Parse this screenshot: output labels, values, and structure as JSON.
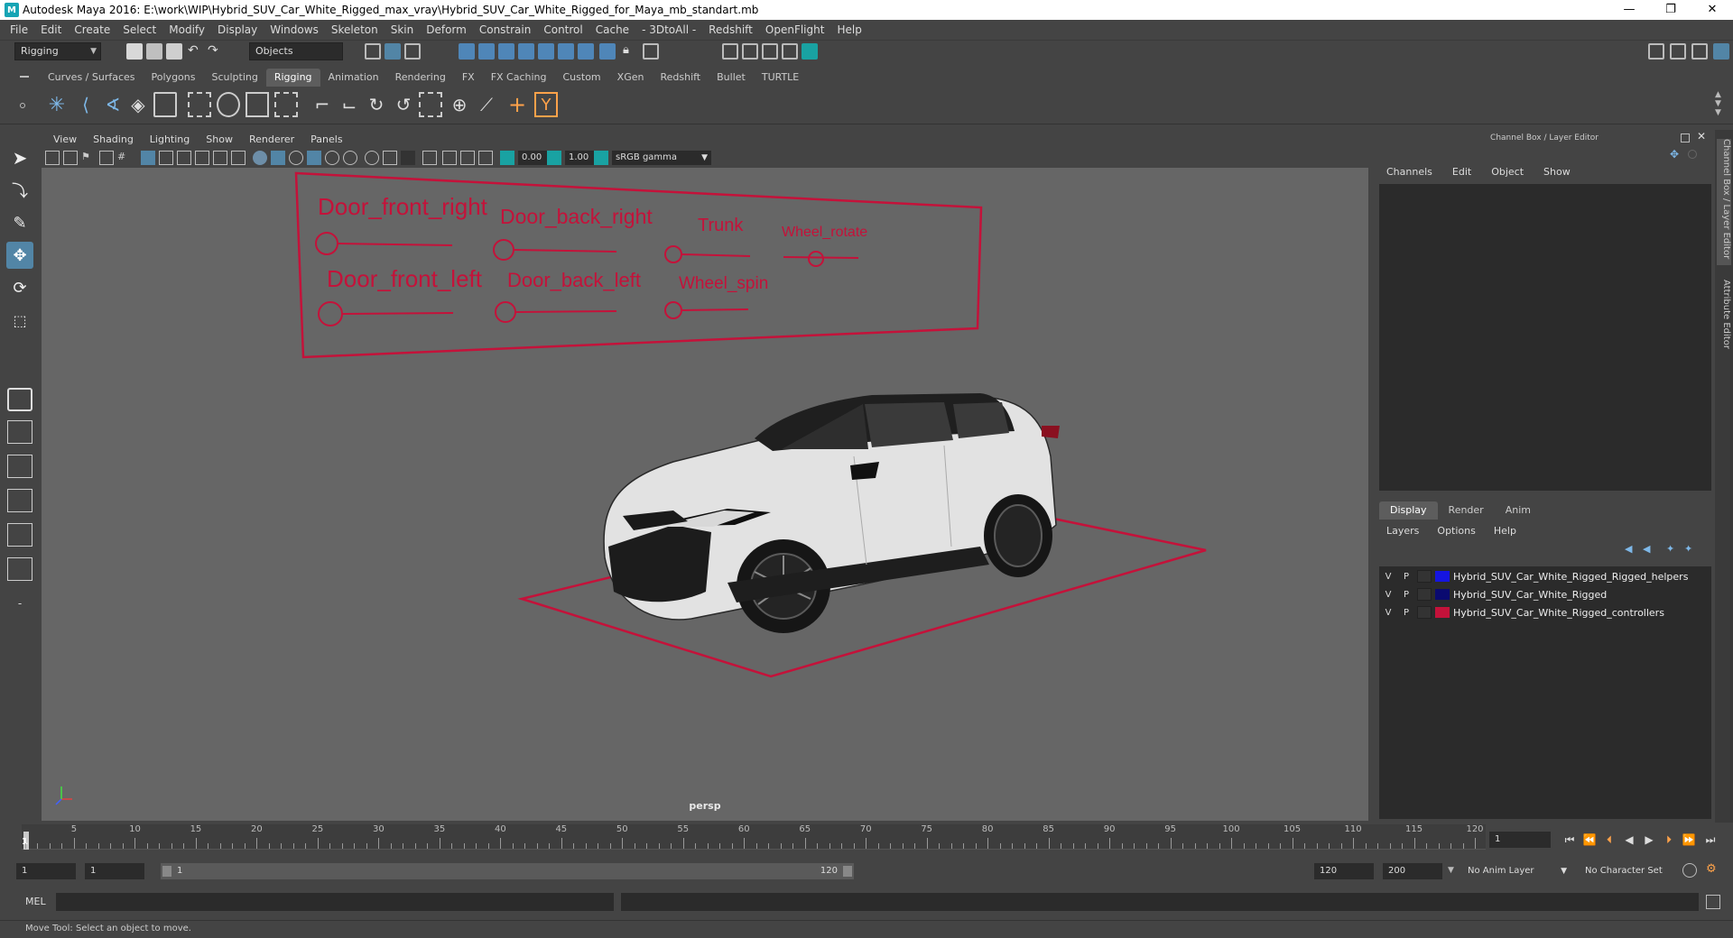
{
  "window": {
    "title": "Autodesk Maya 2016: E:\\work\\WIP\\Hybrid_SUV_Car_White_Rigged_max_vray\\Hybrid_SUV_Car_White_Rigged_for_Maya_mb_standart.mb",
    "min": "—",
    "max": "❐",
    "close": "✕"
  },
  "menubar": [
    "File",
    "Edit",
    "Create",
    "Select",
    "Modify",
    "Display",
    "Windows",
    "Skeleton",
    "Skin",
    "Deform",
    "Constrain",
    "Control",
    "Cache",
    "- 3DtoAll -",
    "Redshift",
    "OpenFlight",
    "Help"
  ],
  "statusline": {
    "menuset": "Rigging",
    "selection_mode": "Objects"
  },
  "shelf_tabs": [
    "Curves / Surfaces",
    "Polygons",
    "Sculpting",
    "Rigging",
    "Animation",
    "Rendering",
    "FX",
    "FX Caching",
    "Custom",
    "XGen",
    "Redshift",
    "Bullet",
    "TURTLE"
  ],
  "shelf_active": "Rigging",
  "viewport": {
    "menu": [
      "View",
      "Shading",
      "Lighting",
      "Show",
      "Renderer",
      "Panels"
    ],
    "near_value": "0.00",
    "gamma_value": "1.00",
    "color_space": "sRGB gamma",
    "camera": "persp",
    "controls_color": "#c4123a",
    "board_labels": {
      "door_front_right": "Door_front_right",
      "door_back_right": "Door_back_right",
      "trunk": "Trunk",
      "wheel_rotate": "Wheel_rotate",
      "door_front_left": "Door_front_left",
      "door_back_left": "Door_back_left",
      "wheel_spin": "Wheel_spin"
    }
  },
  "channelbox": {
    "title": "Channel Box / Layer Editor",
    "menu": [
      "Channels",
      "Edit",
      "Object",
      "Show"
    ]
  },
  "layer_editor": {
    "tabs": [
      "Display",
      "Render",
      "Anim"
    ],
    "active_tab": "Display",
    "menu": [
      "Layers",
      "Options",
      "Help"
    ],
    "layers": [
      {
        "v": "V",
        "p": "P",
        "name": "Hybrid_SUV_Car_White_Rigged_Rigged_helpers",
        "color": "#1515e0"
      },
      {
        "v": "V",
        "p": "P",
        "name": "Hybrid_SUV_Car_White_Rigged",
        "color": "#0a0a70"
      },
      {
        "v": "V",
        "p": "P",
        "name": "Hybrid_SUV_Car_White_Rigged_controllers",
        "color": "#c4123a"
      }
    ]
  },
  "side_rail": [
    "Channel Box / Layer Editor",
    "Attribute Editor"
  ],
  "timeline": {
    "ticks": [
      "5",
      "10",
      "15",
      "20",
      "25",
      "30",
      "35",
      "40",
      "45",
      "50",
      "55",
      "60",
      "65",
      "70",
      "75",
      "80",
      "85",
      "90",
      "95",
      "100",
      "105",
      "110",
      "115",
      "120"
    ],
    "current_marker": "1",
    "current_frame": "1"
  },
  "range": {
    "start": "1",
    "playback_start": "1",
    "bar_start": "1",
    "bar_end": "120",
    "playback_end": "120",
    "end": "200",
    "anim_layer": "No Anim Layer",
    "character_set": "No Character Set"
  },
  "cmdline": {
    "label": "MEL"
  },
  "helpline": {
    "text": "Move Tool: Select an object to move."
  }
}
